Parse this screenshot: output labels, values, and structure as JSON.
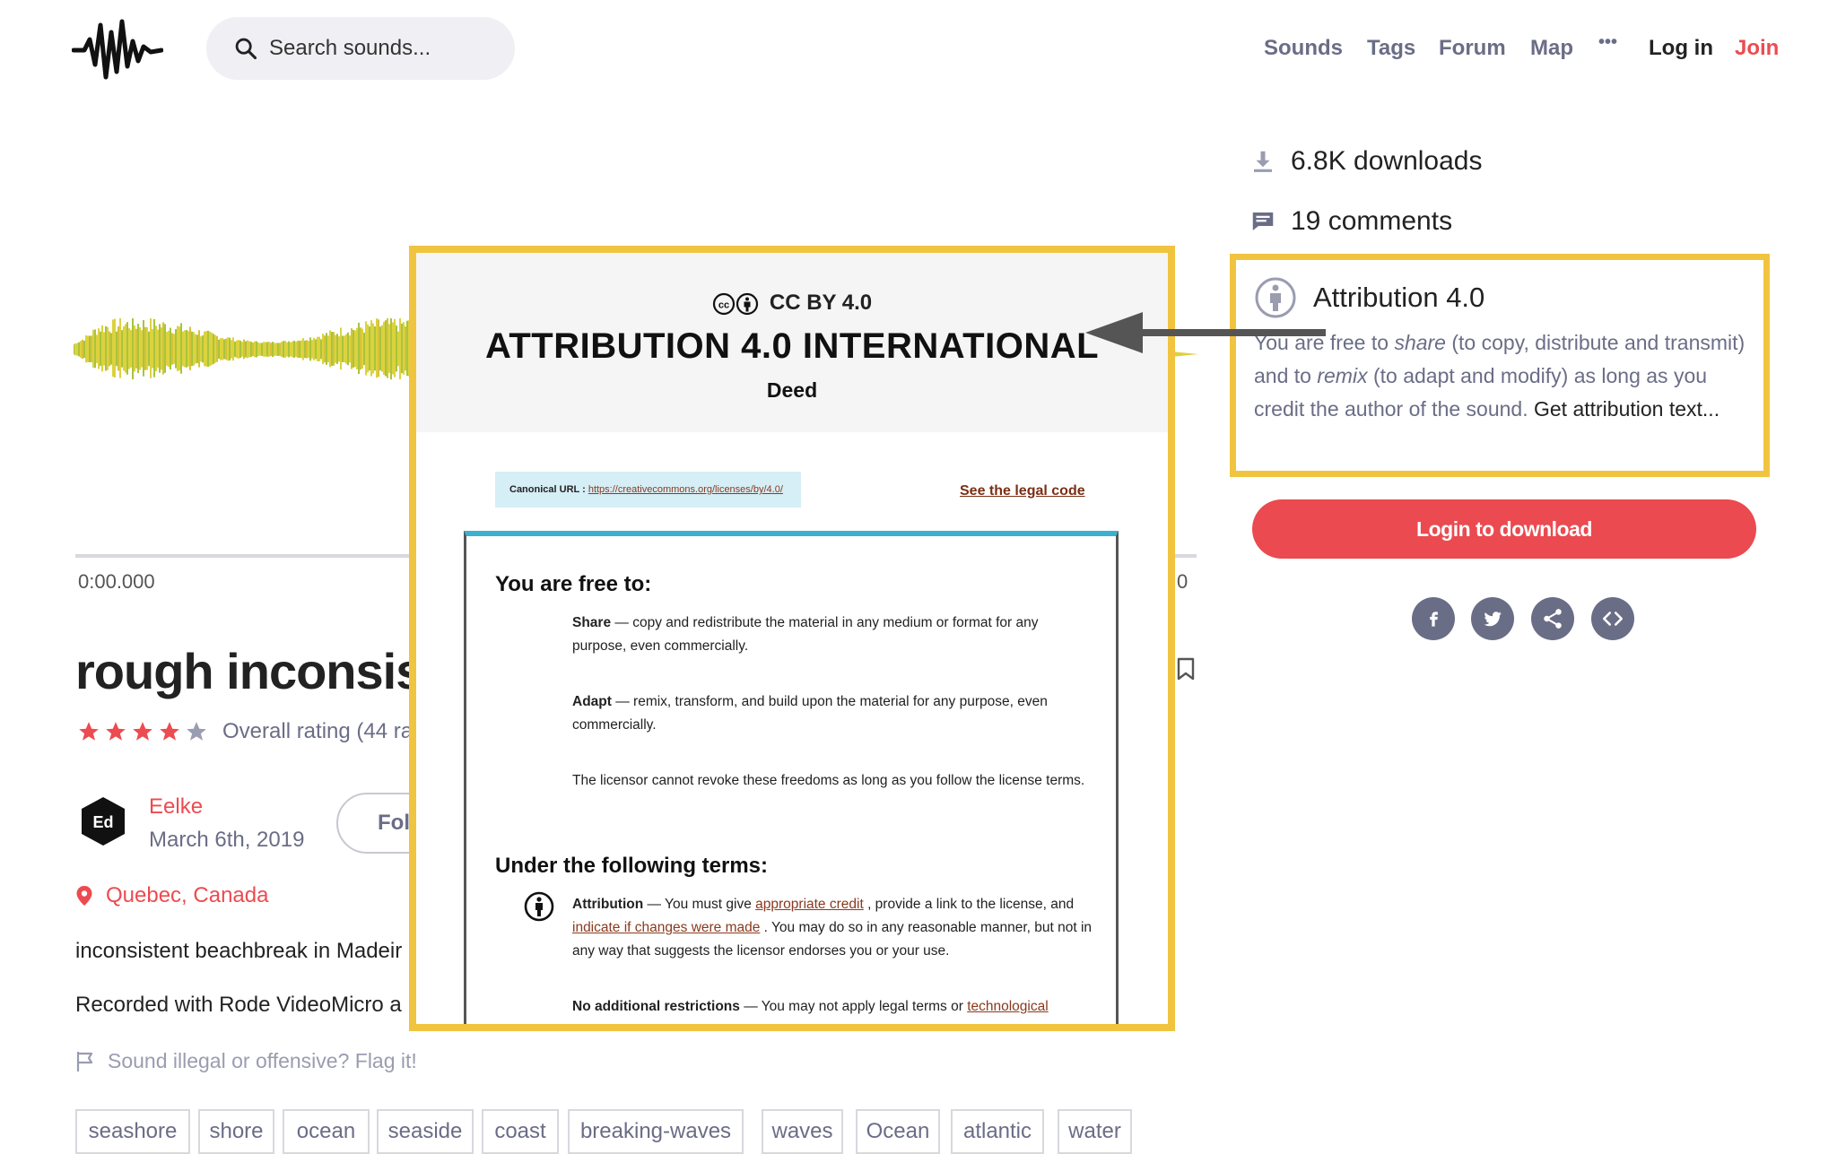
{
  "header": {
    "logo": "freesound-waveform-logo",
    "search_placeholder": "Search sounds...",
    "nav": {
      "sounds": "Sounds",
      "tags": "Tags",
      "forum": "Forum",
      "map": "Map",
      "more": "•••",
      "login": "Log in",
      "join": "Join"
    }
  },
  "player": {
    "time_start": "0:00.000",
    "time_end_partial": "0"
  },
  "sound": {
    "title_partial": "rough inconsis",
    "rating_text": "Overall rating (44 ra",
    "rating_stars": 4,
    "rating_max": 5,
    "user": "Eelke",
    "date": "March 6th, 2019",
    "follow_partial": "Foll",
    "location": "Quebec, Canada",
    "description_line1": "inconsistent beachbreak in Madeir",
    "description_line2": "Recorded with Rode VideoMicro a",
    "flag_text": "Sound illegal or offensive? Flag it!",
    "tags": [
      "seashore",
      "shore",
      "ocean",
      "seaside",
      "coast",
      "breaking-waves",
      "waves",
      "Ocean",
      "atlantic",
      "water"
    ]
  },
  "sidebar": {
    "downloads": "6.8K downloads",
    "comments": "19 comments",
    "license": {
      "name": "Attribution 4.0",
      "text_1": "You are free to ",
      "share": "share",
      "text_2": " (to copy, distribute and transmit) and to ",
      "remix": "remix",
      "text_3": " (to adapt and modify) as long as you credit the author of the sound. ",
      "get_attribution": "Get attribution text..."
    },
    "download_button": "Login to download",
    "share_icons": [
      "facebook-icon",
      "twitter-icon",
      "share-icon",
      "embed-icon"
    ]
  },
  "deed": {
    "badge": "CC BY 4.0",
    "title": "ATTRIBUTION 4.0 INTERNATIONAL",
    "subtitle": "Deed",
    "canonical_label": "Canonical URL :",
    "canonical_url": "https://creativecommons.org/licenses/by/4.0/",
    "legal_code_link": "See the legal code",
    "free_heading": "You are free to:",
    "share_term": "Share",
    "share_desc": " — copy and redistribute the material in any medium or format for any purpose, even commercially.",
    "adapt_term": "Adapt",
    "adapt_desc": " — remix, transform, and build upon the material for any purpose, even commercially.",
    "revoke_text": "The licensor cannot revoke these freedoms as long as you follow the license terms.",
    "terms_heading": "Under the following terms:",
    "attribution_term": "Attribution",
    "attr_desc_1": " — You must give ",
    "attr_link_1": "appropriate credit",
    "attr_desc_2": " , provide a link to the license, and ",
    "attr_link_2": "indicate if changes were made",
    "attr_desc_3": " . You may do so in any reasonable manner, but not in any way that suggests the licensor endorses you or your use.",
    "no_restrictions_term": "No additional restrictions",
    "no_restrictions_desc": " — You may not apply legal terms or ",
    "no_restrictions_link": "technological"
  },
  "colors": {
    "accent": "#ec4b50",
    "highlight": "#f1c440",
    "muted": "#6a6d86",
    "waveform": "#c8d43a"
  }
}
